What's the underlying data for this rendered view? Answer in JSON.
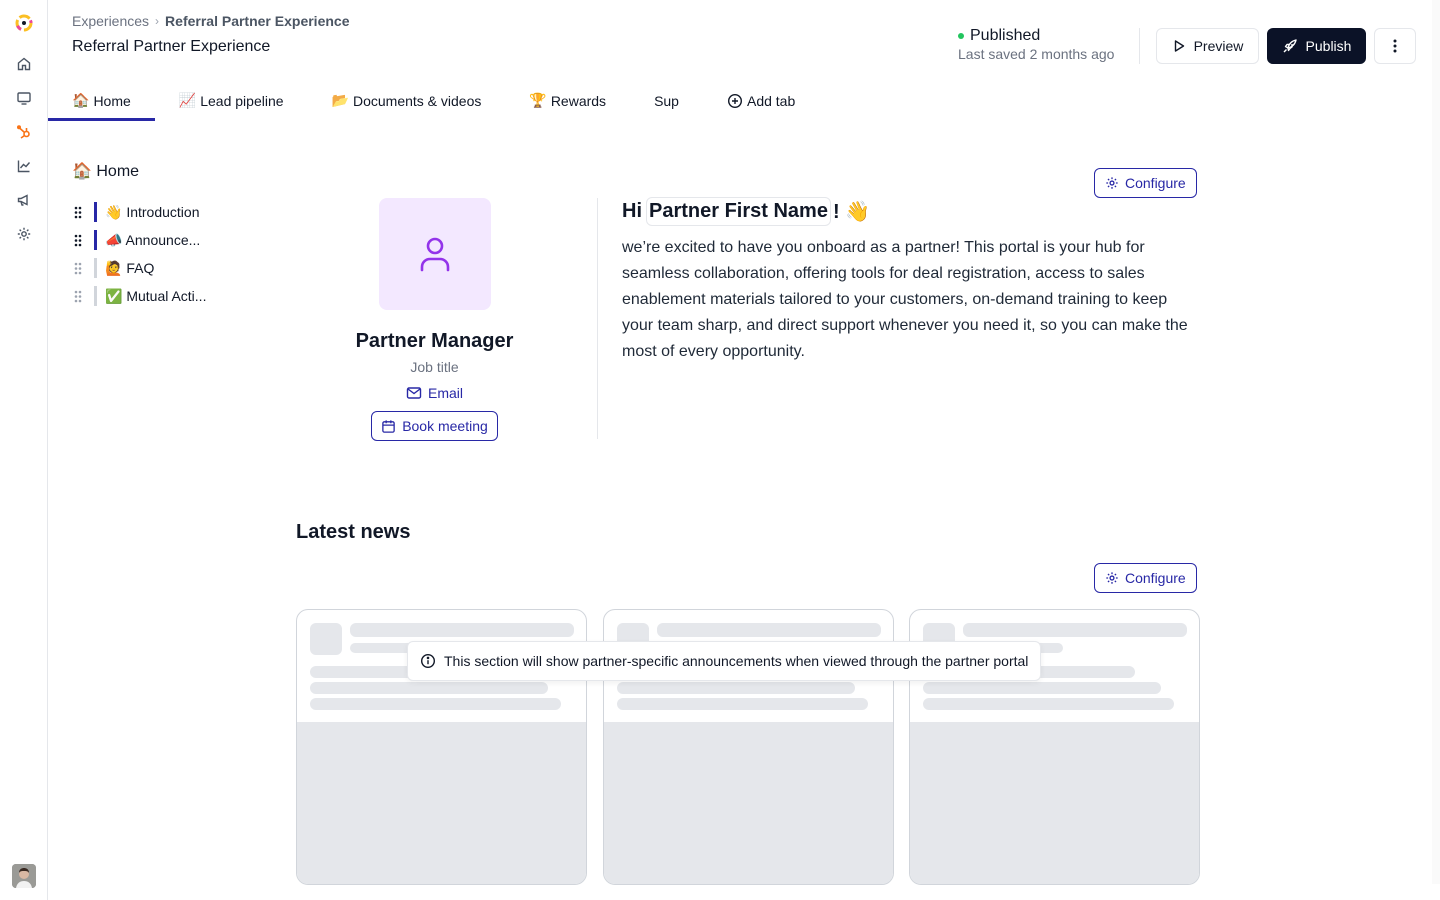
{
  "header": {
    "breadcrumb": {
      "parent": "Experiences",
      "separator": "›",
      "current": "Referral Partner Experience"
    },
    "title": "Referral Partner Experience",
    "status": {
      "label": "Published",
      "color": "#22c55e",
      "last_saved": "Last saved 2 months ago"
    },
    "buttons": {
      "preview": "Preview",
      "publish": "Publish"
    }
  },
  "rail": {
    "icons": [
      "app-logo-icon",
      "home-icon",
      "monitor-icon",
      "hubspot-icon",
      "chart-icon",
      "megaphone-icon",
      "settings-icon"
    ]
  },
  "tabs": [
    {
      "emoji": "🏠",
      "label": "Home",
      "active": true
    },
    {
      "emoji": "📈",
      "label": "Lead pipeline"
    },
    {
      "emoji": "📂",
      "label": "Documents & videos"
    },
    {
      "emoji": "🏆",
      "label": "Rewards"
    },
    {
      "emoji": "",
      "label": "Sup"
    },
    {
      "emoji": "",
      "label": "Add tab"
    }
  ],
  "outline": {
    "title": "🏠 Home",
    "items": [
      {
        "label": "👋 Introduction",
        "active": true
      },
      {
        "label": "📣 Announce...",
        "active": true
      },
      {
        "label": "🙋 FAQ",
        "active": false
      },
      {
        "label": "✅ Mutual Acti...",
        "active": false
      }
    ]
  },
  "intro": {
    "configure_label": "Configure",
    "profile": {
      "name": "Partner Manager",
      "job_title": "Job title",
      "email_label": "Email",
      "book_label": "Book meeting"
    },
    "greeting": {
      "prefix": "Hi",
      "token": "Partner First Name",
      "suffix": "! 👋"
    },
    "body": "we’re excited to have you onboard as a partner! This portal is your hub for seamless collaboration, offering tools for deal registration, access to sales enablement materials tailored to your customers, on-demand training to keep your team sharp, and direct support whenever you need it, so you can make the most of every opportunity."
  },
  "news": {
    "title": "Latest news",
    "configure_label": "Configure",
    "tooltip": "This section will show partner-specific announcements when viewed through the partner portal",
    "card_count": 3
  },
  "colors": {
    "accent": "#2828a6",
    "primary_button": "#0b1227",
    "avatar_bg": "#f3e8ff",
    "avatar_icon": "#9333ea"
  }
}
